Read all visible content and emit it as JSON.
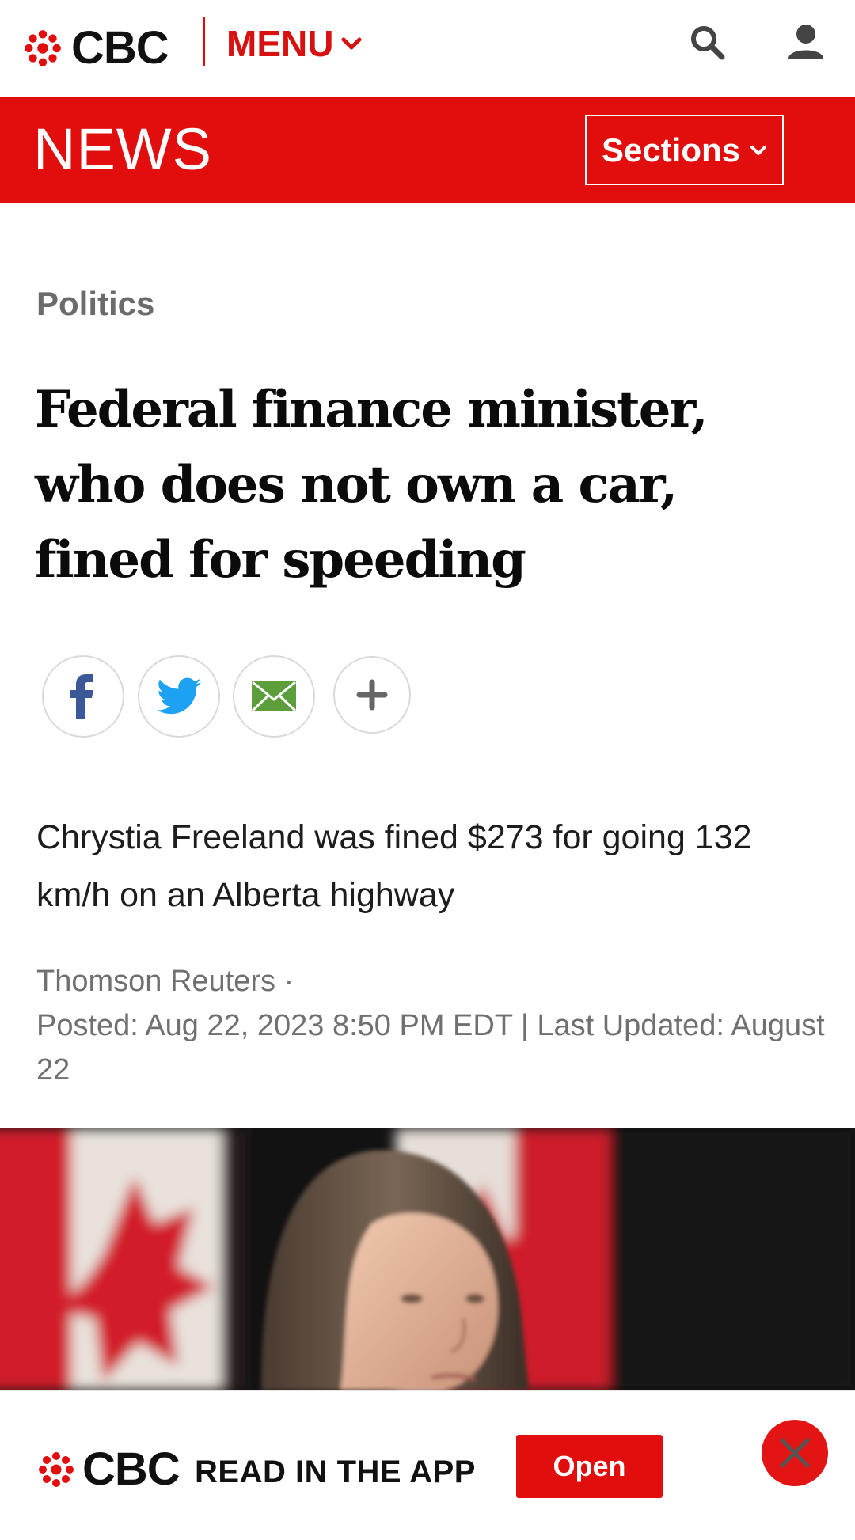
{
  "header": {
    "brand": "CBC",
    "menu_label": "MENU",
    "icons": [
      "cbc-gem-icon",
      "chevron-down-icon",
      "search-icon",
      "user-icon"
    ]
  },
  "newsbar": {
    "title": "NEWS",
    "sections_label": "Sections"
  },
  "article": {
    "category": "Politics",
    "headline": "Federal finance minister, who does not own a car, fined for speeding",
    "share": [
      "facebook-icon",
      "twitter-icon",
      "email-icon",
      "plus-icon"
    ],
    "dek": "Chrystia Freeland was fined $273 for going 132 km/h on an Alberta highway",
    "author": "Thomson Reuters ·",
    "dates": "Posted: Aug 22, 2023 8:50 PM EDT | Last Updated: August 22"
  },
  "app_banner": {
    "brand": "CBC",
    "text": "READ IN THE APP",
    "open_label": "Open"
  },
  "colors": {
    "brand_red": "#e20d0d",
    "menu_red": "#d6110f",
    "category_gray": "#6b6b6b",
    "byline_gray": "#707070",
    "facebook_blue": "#3b5998",
    "twitter_blue": "#1da1f2",
    "email_green": "#5b9e3b"
  }
}
